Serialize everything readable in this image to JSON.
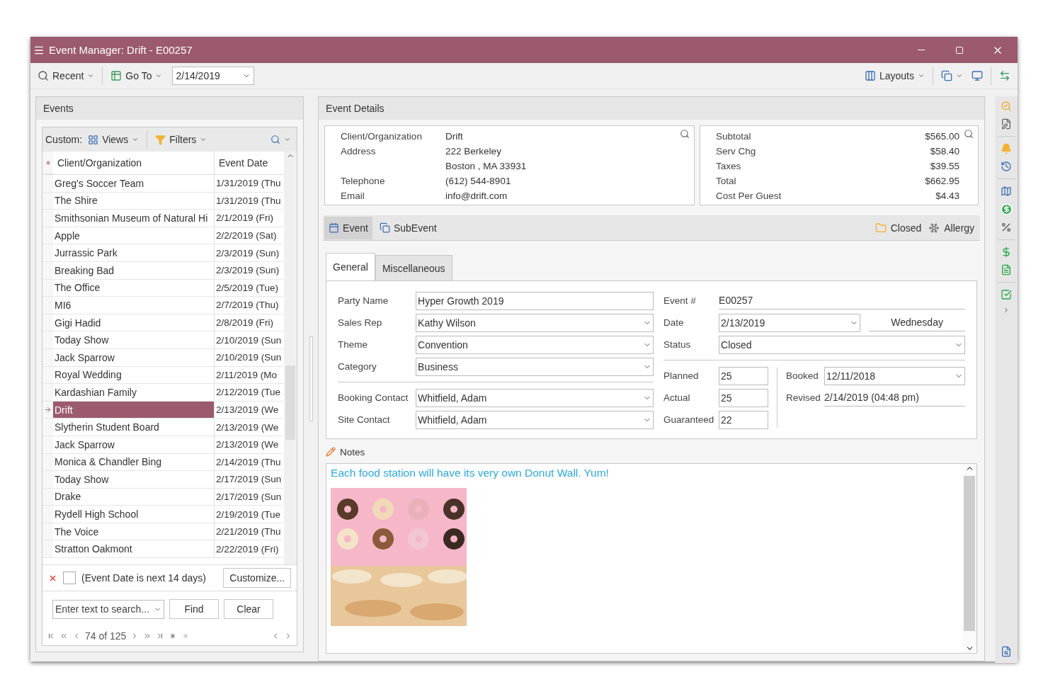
{
  "window": {
    "title": "Event Manager: Drift - E00257"
  },
  "toolbar": {
    "recent": "Recent",
    "go_to": "Go To",
    "date": "2/14/2019",
    "layouts": "Layouts"
  },
  "events_panel": {
    "title": "Events",
    "custom_label": "Custom:",
    "views": "Views",
    "filters": "Filters",
    "columns": [
      "Client/Organization",
      "Event Date"
    ],
    "rows": [
      {
        "name": "Greg's Soccer Team",
        "date": "1/31/2019 (Thu",
        "selected": false
      },
      {
        "name": "The Shire",
        "date": "1/31/2019 (Thu",
        "selected": false
      },
      {
        "name": "Smithsonian Museum of Natural Hi",
        "date": "2/1/2019 (Fri)",
        "selected": false
      },
      {
        "name": "Apple",
        "date": "2/2/2019 (Sat)",
        "selected": false
      },
      {
        "name": "Jurrassic Park",
        "date": "2/3/2019 (Sun)",
        "selected": false
      },
      {
        "name": "Breaking Bad",
        "date": "2/3/2019 (Sun)",
        "selected": false
      },
      {
        "name": "The Office",
        "date": "2/5/2019 (Tue)",
        "selected": false
      },
      {
        "name": "MI6",
        "date": "2/7/2019 (Thu)",
        "selected": false
      },
      {
        "name": "Gigi Hadid",
        "date": "2/8/2019 (Fri)",
        "selected": false
      },
      {
        "name": "Today Show",
        "date": "2/10/2019 (Sun",
        "selected": false
      },
      {
        "name": "Jack Sparrow",
        "date": "2/10/2019 (Sun",
        "selected": false
      },
      {
        "name": "Royal Wedding",
        "date": "2/11/2019 (Mo",
        "selected": false
      },
      {
        "name": "Kardashian Family",
        "date": "2/12/2019 (Tue",
        "selected": false
      },
      {
        "name": "Drift",
        "date": "2/13/2019 (We",
        "selected": true
      },
      {
        "name": "Slytherin Student Board",
        "date": "2/13/2019 (We",
        "selected": false
      },
      {
        "name": "Jack Sparrow",
        "date": "2/13/2019 (We",
        "selected": false
      },
      {
        "name": "Monica & Chandler Bing",
        "date": "2/14/2019 (Thu",
        "selected": false
      },
      {
        "name": "Today Show",
        "date": "2/17/2019 (Sun",
        "selected": false
      },
      {
        "name": "Drake",
        "date": "2/17/2019 (Sun",
        "selected": false
      },
      {
        "name": "Rydell High School",
        "date": "2/19/2019 (Tue",
        "selected": false
      },
      {
        "name": "The Voice",
        "date": "2/21/2019 (Thu",
        "selected": false
      },
      {
        "name": "Stratton Oakmont",
        "date": "2/22/2019 (Fri)",
        "selected": false
      }
    ],
    "filter": {
      "checked": false,
      "text": "(Event Date is next 14 days)",
      "customize": "Customize..."
    },
    "search": {
      "placeholder": "Enter text to search...",
      "find": "Find",
      "clear": "Clear"
    },
    "pager": "74 of 125"
  },
  "details_panel": {
    "title": "Event Details",
    "contact": [
      {
        "label": "Client/Organization",
        "value": "Drift"
      },
      {
        "label": "Address",
        "value": "222 Berkeley"
      },
      {
        "value": "Boston , MA 33931"
      },
      {
        "label": "Telephone",
        "value": "(612) 544-8901"
      },
      {
        "label": "Email",
        "value": "info@drift.com"
      }
    ],
    "totals": [
      {
        "label": "Subtotal",
        "value": "$565.00"
      },
      {
        "label": "Serv Chg",
        "value": "$58.40"
      },
      {
        "label": "Taxes",
        "value": "$39.55"
      },
      {
        "label": "Total",
        "value": "$662.95"
      },
      {
        "label": "Cost Per Guest",
        "value": "$4.43"
      }
    ],
    "tabs": [
      {
        "label": "Event",
        "selected": true
      },
      {
        "label": "SubEvent",
        "selected": false
      }
    ],
    "flags": [
      {
        "kind": "folder",
        "label": "Closed"
      },
      {
        "kind": "snowflake",
        "label": "Allergy"
      }
    ],
    "form_tabs": [
      {
        "label": "General",
        "selected": true
      },
      {
        "label": "Miscellaneous",
        "selected": false
      }
    ],
    "event_fields": [
      {
        "label": "Party Name",
        "value": "Hyper Growth 2019",
        "kind": "text"
      },
      {
        "label": "Sales Rep",
        "value": "Kathy Wilson",
        "kind": "select"
      },
      {
        "label": "Theme",
        "value": "Convention",
        "kind": "select"
      },
      {
        "label": "Category",
        "value": "Business",
        "kind": "select"
      }
    ],
    "contact_fields": [
      {
        "label": "Booking Contact",
        "value": "Whitfield, Adam",
        "kind": "select"
      },
      {
        "label": "Site Contact",
        "value": "Whitfield, Adam",
        "kind": "select"
      }
    ],
    "status_fields": [
      {
        "label": "Event #",
        "value": "E00257",
        "kind": "static"
      },
      {
        "label": "Date",
        "value": "2/13/2019",
        "kind": "select",
        "weekday": "Wednesday"
      },
      {
        "label": "Status",
        "value": "Closed",
        "kind": "select"
      }
    ],
    "counts": [
      {
        "label": "Planned",
        "value": "25",
        "kind": "text"
      },
      {
        "label": "Actual",
        "value": "25",
        "kind": "text"
      },
      {
        "label": "Guaranteed",
        "value": "22",
        "kind": "text"
      }
    ],
    "dates": [
      {
        "label": "Booked",
        "value": "12/11/2018",
        "kind": "select"
      },
      {
        "label": "Revised",
        "value": "2/14/2019 (04:48 pm)",
        "kind": "static"
      }
    ],
    "notes": {
      "title": "Notes",
      "text": "Each food station will have its very own Donut Wall. Yum!"
    }
  }
}
